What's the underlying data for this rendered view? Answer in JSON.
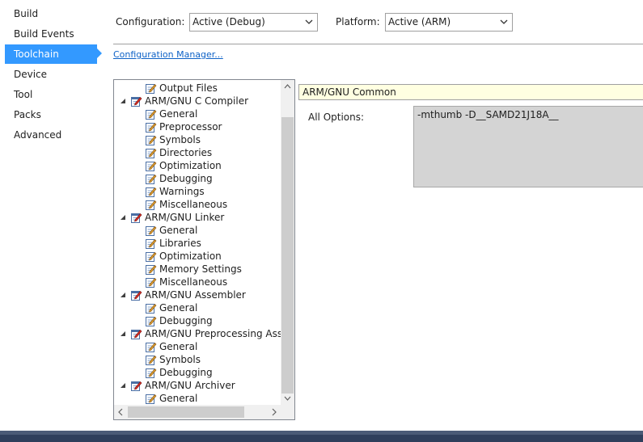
{
  "nav": {
    "items": [
      {
        "label": "Build",
        "active": false
      },
      {
        "label": "Build Events",
        "active": false
      },
      {
        "label": "Toolchain",
        "active": true
      },
      {
        "label": "Device",
        "active": false
      },
      {
        "label": "Tool",
        "active": false
      },
      {
        "label": "Packs",
        "active": false
      },
      {
        "label": "Advanced",
        "active": false
      }
    ]
  },
  "toolbar": {
    "configuration_label": "Configuration:",
    "configuration_value": "Active (Debug)",
    "platform_label": "Platform:",
    "platform_value": "Active (ARM)",
    "config_manager_link": "Configuration Manager..."
  },
  "tree": {
    "items": [
      {
        "label": "Output Files",
        "level": 1
      },
      {
        "label": "ARM/GNU C Compiler",
        "level": 0,
        "expanded": true
      },
      {
        "label": "General",
        "level": 1
      },
      {
        "label": "Preprocessor",
        "level": 1
      },
      {
        "label": "Symbols",
        "level": 1
      },
      {
        "label": "Directories",
        "level": 1
      },
      {
        "label": "Optimization",
        "level": 1
      },
      {
        "label": "Debugging",
        "level": 1
      },
      {
        "label": "Warnings",
        "level": 1
      },
      {
        "label": "Miscellaneous",
        "level": 1
      },
      {
        "label": "ARM/GNU Linker",
        "level": 0,
        "expanded": true
      },
      {
        "label": "General",
        "level": 1
      },
      {
        "label": "Libraries",
        "level": 1
      },
      {
        "label": "Optimization",
        "level": 1
      },
      {
        "label": "Memory Settings",
        "level": 1
      },
      {
        "label": "Miscellaneous",
        "level": 1
      },
      {
        "label": "ARM/GNU Assembler",
        "level": 0,
        "expanded": true
      },
      {
        "label": "General",
        "level": 1
      },
      {
        "label": "Debugging",
        "level": 1
      },
      {
        "label": "ARM/GNU Preprocessing Assembler",
        "level": 0,
        "expanded": true
      },
      {
        "label": "General",
        "level": 1
      },
      {
        "label": "Symbols",
        "level": 1
      },
      {
        "label": "Debugging",
        "level": 1
      },
      {
        "label": "ARM/GNU Archiver",
        "level": 0,
        "expanded": true
      },
      {
        "label": "General",
        "level": 1
      }
    ]
  },
  "panel": {
    "section_title": "ARM/GNU Common",
    "all_options_label": "All Options:",
    "all_options_value": "-mthumb -D__SAMD21J18A__"
  },
  "colors": {
    "accent": "#3399ff",
    "link": "#0e62c7",
    "header_bg": "#ffffe1",
    "options_bg": "#d4d4d4",
    "taskbar": "#2f3f5c"
  }
}
